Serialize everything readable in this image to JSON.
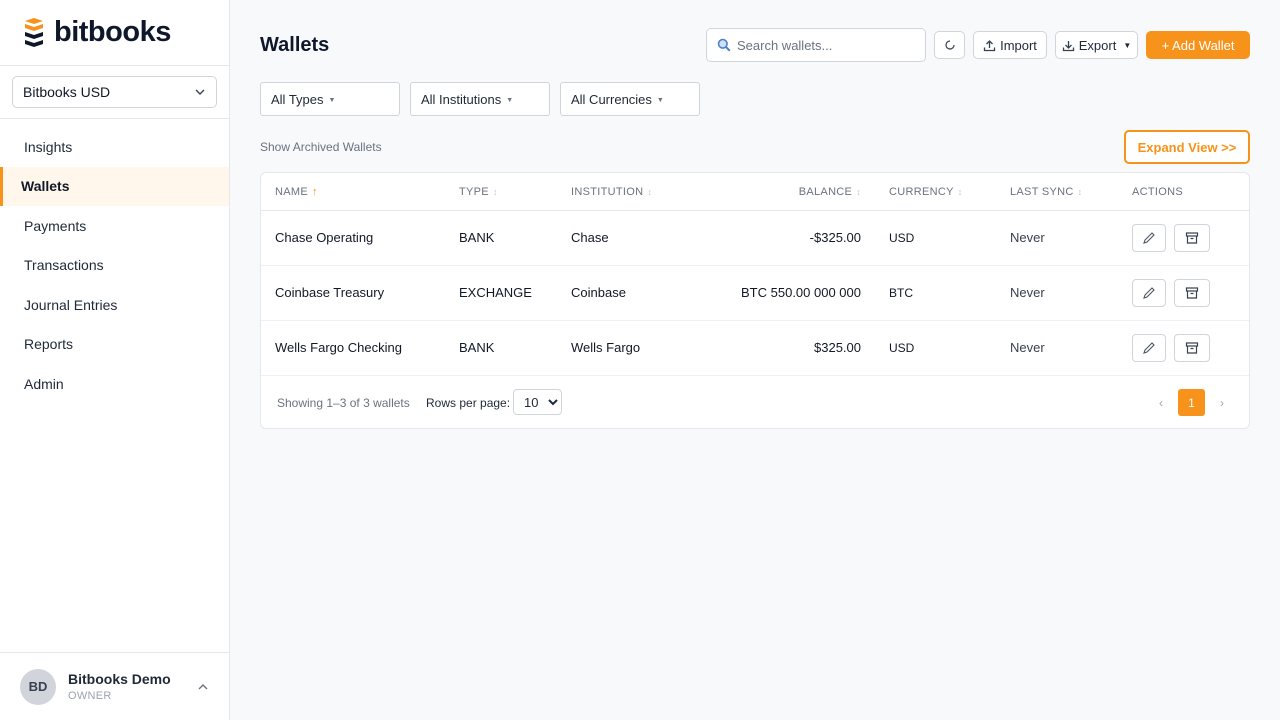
{
  "app": {
    "brand": "bitbooks",
    "accent_color": "#f7931a"
  },
  "sidebar": {
    "org_selector": "Bitbooks USD",
    "items": [
      {
        "label": "Insights",
        "active": false
      },
      {
        "label": "Wallets",
        "active": true
      },
      {
        "label": "Payments",
        "active": false
      },
      {
        "label": "Transactions",
        "active": false
      },
      {
        "label": "Journal Entries",
        "active": false
      },
      {
        "label": "Reports",
        "active": false
      },
      {
        "label": "Admin",
        "active": false
      }
    ],
    "user": {
      "initials": "BD",
      "name": "Bitbooks Demo",
      "role": "OWNER"
    }
  },
  "header": {
    "title": "Wallets",
    "search_placeholder": "Search wallets...",
    "search_value": "",
    "import_label": "Import",
    "export_label": "Export",
    "add_label": "+ Add Wallet"
  },
  "filters": {
    "types": "All Types",
    "institutions": "All Institutions",
    "currencies": "All Currencies"
  },
  "archived_link": "Show Archived Wallets",
  "expand_label": "Expand View >>",
  "table": {
    "columns": {
      "name": "NAME",
      "type": "TYPE",
      "institution": "INSTITUTION",
      "balance": "BALANCE",
      "currency": "CURRENCY",
      "last_sync": "LAST SYNC",
      "actions": "ACTIONS"
    },
    "sort_asc_glyph": "↑",
    "sort_glyph": "↕",
    "rows": [
      {
        "name": "Chase Operating",
        "type": "BANK",
        "institution": "Chase",
        "balance": "-$325.00",
        "currency": "USD",
        "last_sync": "Never"
      },
      {
        "name": "Coinbase Treasury",
        "type": "EXCHANGE",
        "institution": "Coinbase",
        "balance": "BTC 550.00 000 000",
        "currency": "BTC",
        "last_sync": "Never"
      },
      {
        "name": "Wells Fargo Checking",
        "type": "BANK",
        "institution": "Wells Fargo",
        "balance": "$325.00",
        "currency": "USD",
        "last_sync": "Never"
      }
    ]
  },
  "footer": {
    "showing": "Showing 1–3 of 3 wallets",
    "rows_per_page_label": "Rows per page:",
    "rows_per_page": "10",
    "prev": "‹",
    "next": "›",
    "current_page": "1"
  }
}
